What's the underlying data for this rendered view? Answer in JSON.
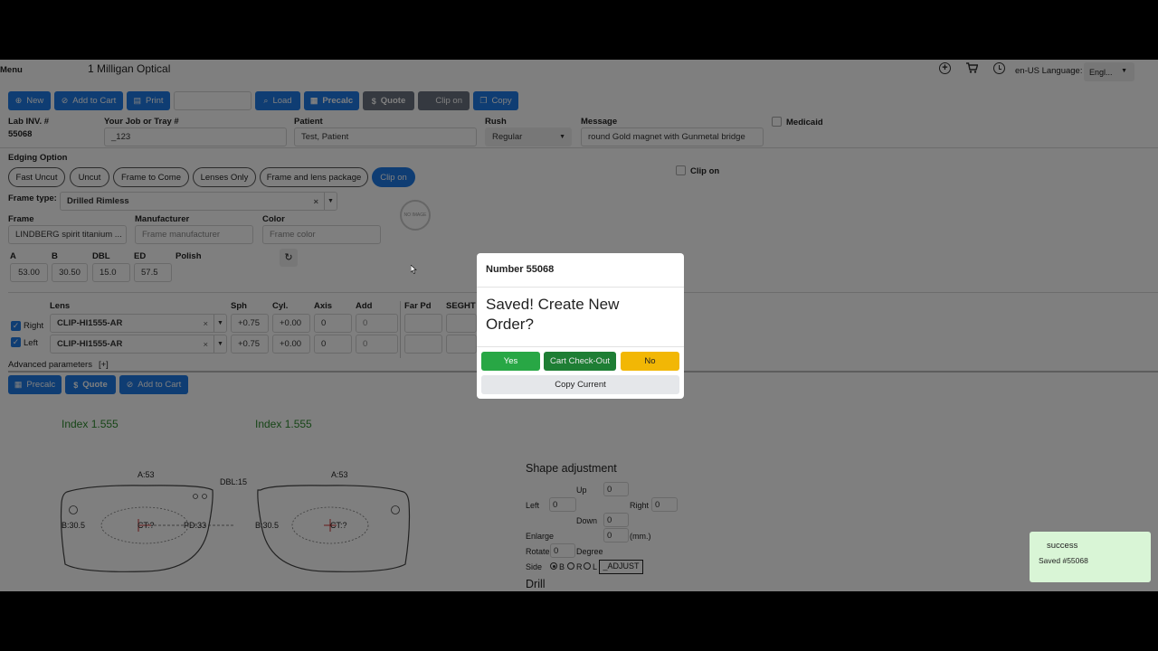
{
  "header": {
    "menu_label": "Menu",
    "app_title": "1 Milligan Optical",
    "locale_text": "en-US Language:",
    "language_value": "Engl...",
    "icons": [
      "plus-circle-icon",
      "cart-icon",
      "clock-icon"
    ]
  },
  "toolbar": {
    "new": "New",
    "add_to_cart": "Add to Cart",
    "print": "Print",
    "load": "Load",
    "precalc": "Precalc",
    "quote": "Quote",
    "clip_on": "Clip on",
    "copy": "Copy"
  },
  "order": {
    "lab_inv_label": "Lab INV. #",
    "lab_inv_value": "55068",
    "job_label": "Your Job or Tray #",
    "job_value": "_123",
    "patient_label": "Patient",
    "patient_value": "Test, Patient",
    "rush_label": "Rush",
    "rush_value": "Regular",
    "message_label": "Message",
    "message_value": "round Gold magnet with Gunmetal bridge",
    "medicaid_label": "Medicaid"
  },
  "edging": {
    "label": "Edging Option",
    "options": [
      "Fast Uncut",
      "Uncut",
      "Frame to Come",
      "Lenses Only",
      "Frame and lens package",
      "Clip on"
    ],
    "active": "Clip on",
    "clip_on_checkbox": "Clip on"
  },
  "frame": {
    "type_label": "Frame type:",
    "type_value": "Drilled Rimless",
    "no_image_text": "NO IMAGE",
    "frame_label": "Frame",
    "frame_value": "LINDBERG spirit titanium ...",
    "manufacturer_label": "Manufacturer",
    "manufacturer_placeholder": "Frame manufacturer",
    "color_label": "Color",
    "color_placeholder": "Frame color",
    "a_label": "A",
    "a_value": "53.00",
    "b_label": "B",
    "b_value": "30.50",
    "dbl_label": "DBL",
    "dbl_value": "15.0",
    "ed_label": "ED",
    "ed_value": "57.5",
    "polish_label": "Polish"
  },
  "lens_table": {
    "headers": {
      "lens": "Lens",
      "sph": "Sph",
      "cyl": "Cyl.",
      "axis": "Axis",
      "add": "Add",
      "far_pd": "Far Pd",
      "seght": "SEGHT"
    },
    "rows": [
      {
        "side": "Right",
        "lens": "CLIP-HI1555-AR",
        "sph": "+0.75",
        "cyl": "+0.00",
        "axis": "0",
        "add": "0"
      },
      {
        "side": "Left",
        "lens": "CLIP-HI1555-AR",
        "sph": "+0.75",
        "cyl": "+0.00",
        "axis": "0",
        "add": "0"
      }
    ],
    "advanced_label": "Advanced parameters",
    "advanced_toggle": "[+]"
  },
  "bottom_toolbar": {
    "precalc": "Precalc",
    "quote": "Quote",
    "add_to_cart": "Add to Cart"
  },
  "drawing": {
    "left_index": "Index 1.555",
    "right_index": "Index 1.555",
    "left_a": "A:53",
    "right_a": "A:53",
    "dbl": "DBL:15",
    "left_b": "B:30.5",
    "right_b": "B:30.5",
    "left_ct": "CT:?",
    "right_ct": "CT:?",
    "pd": "PD:33"
  },
  "shape_adjustment": {
    "title": "Shape adjustment",
    "up_label": "Up",
    "up_value": "0",
    "left_label": "Left",
    "left_value": "0",
    "right_label": "Right",
    "right_value": "0",
    "down_label": "Down",
    "down_value": "0",
    "enlarge_label": "Enlarge",
    "enlarge_value": "0",
    "enlarge_unit": "(mm.)",
    "rotate_label": "Rotate",
    "rotate_value": "0",
    "rotate_unit": "Degree",
    "side_label": "Side",
    "side_options": [
      "B",
      "R",
      "L"
    ],
    "side_selected": "B",
    "adjust_button": "_ADJUST",
    "drill_title": "Drill"
  },
  "modal": {
    "title": "Number 55068",
    "message": "Saved! Create New Order?",
    "yes": "Yes",
    "checkout": "Cart Check-Out",
    "no": "No",
    "copy_current": "Copy Current"
  },
  "toast": {
    "title": "success",
    "message": "Saved #55068"
  },
  "colors": {
    "primary": "#1e7ae6",
    "success": "#28a745",
    "dark_success": "#1e7e34",
    "warning": "#f2b705",
    "index_green": "#2e8b2e",
    "toast_bg": "#d9f5d6"
  }
}
